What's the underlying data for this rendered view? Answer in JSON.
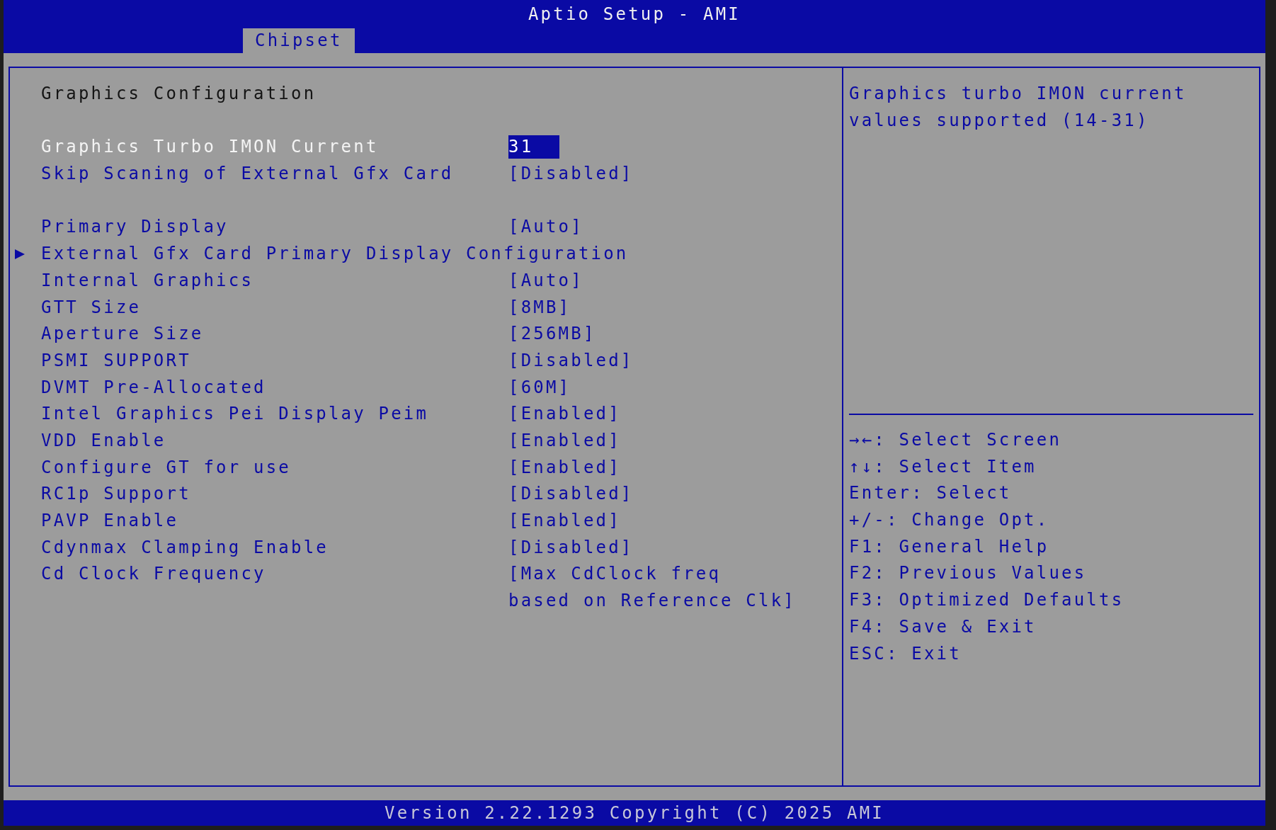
{
  "window": {
    "title": "Aptio Setup - AMI"
  },
  "tabs": [
    {
      "label": "Chipset",
      "selected": true
    }
  ],
  "settings": {
    "heading": "Graphics Configuration",
    "groups": [
      [
        {
          "kind": "option",
          "label": "Graphics Turbo IMON Current",
          "value_lines": [
            "31"
          ],
          "selected": true
        },
        {
          "kind": "option",
          "label": "Skip Scaning of External Gfx Card",
          "value_lines": [
            "[Disabled]"
          ],
          "selected": false
        }
      ],
      [
        {
          "kind": "option",
          "label": "Primary Display",
          "value_lines": [
            "[Auto]"
          ],
          "selected": false
        },
        {
          "kind": "submenu",
          "label": "External Gfx Card Primary Display Configuration",
          "selected": false
        },
        {
          "kind": "option",
          "label": "Internal Graphics",
          "value_lines": [
            "[Auto]"
          ],
          "selected": false
        },
        {
          "kind": "option",
          "label": "GTT Size",
          "value_lines": [
            "[8MB]"
          ],
          "selected": false
        },
        {
          "kind": "option",
          "label": "Aperture Size",
          "value_lines": [
            "[256MB]"
          ],
          "selected": false
        },
        {
          "kind": "option",
          "label": "PSMI SUPPORT",
          "value_lines": [
            "[Disabled]"
          ],
          "selected": false
        },
        {
          "kind": "option",
          "label": "DVMT Pre-Allocated",
          "value_lines": [
            "[60M]"
          ],
          "selected": false
        },
        {
          "kind": "option",
          "label": "Intel Graphics Pei Display Peim",
          "value_lines": [
            "[Enabled]"
          ],
          "selected": false
        },
        {
          "kind": "option",
          "label": "VDD Enable",
          "value_lines": [
            "[Enabled]"
          ],
          "selected": false
        },
        {
          "kind": "option",
          "label": "Configure GT for use",
          "value_lines": [
            "[Enabled]"
          ],
          "selected": false
        },
        {
          "kind": "option",
          "label": "RC1p Support",
          "value_lines": [
            "[Disabled]"
          ],
          "selected": false
        },
        {
          "kind": "option",
          "label": "PAVP Enable",
          "value_lines": [
            "[Enabled]"
          ],
          "selected": false
        },
        {
          "kind": "option",
          "label": "Cdynmax Clamping Enable",
          "value_lines": [
            "[Disabled]"
          ],
          "selected": false
        },
        {
          "kind": "option",
          "label": "Cd Clock Frequency",
          "value_lines": [
            "[Max CdClock freq",
            "based on Reference Clk]"
          ],
          "selected": false
        }
      ]
    ]
  },
  "help": {
    "text": "Graphics turbo IMON current values supported (14-31)",
    "keys": [
      "→←: Select Screen",
      "↑↓: Select Item",
      "Enter: Select",
      "+/-: Change Opt.",
      "F1: General Help",
      "F2: Previous Values",
      "F3: Optimized Defaults",
      "F4: Save & Exit",
      "ESC: Exit"
    ]
  },
  "status_bar": "Version 2.22.1293 Copyright (C) 2025 AMI"
}
